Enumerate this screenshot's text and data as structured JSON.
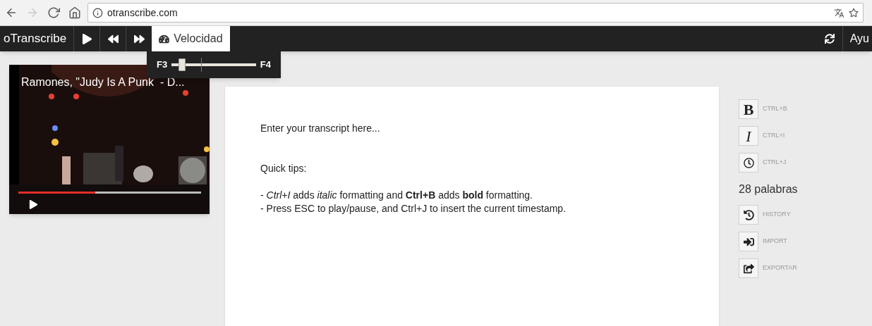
{
  "browser": {
    "url": "otranscribe.com",
    "nav": [
      {
        "kind": "back",
        "disabled": false
      },
      {
        "kind": "forward",
        "disabled": true
      },
      {
        "kind": "reload",
        "disabled": false
      },
      {
        "kind": "home",
        "disabled": false
      }
    ]
  },
  "toolbar": {
    "brand": "oTranscribe",
    "controls": [
      {
        "kind": "play"
      },
      {
        "kind": "rewind"
      },
      {
        "kind": "fastforward"
      }
    ],
    "speed": {
      "label": "Velocidad",
      "selected": true
    },
    "help": "Ayu"
  },
  "speed_popover": {
    "min_label": "F3",
    "max_label": "F4",
    "level": 0.12
  },
  "video": {
    "kind": "picture",
    "title": "Ramones, \"Judy Is A Punk  - D...",
    "progress": {
      "level": 0.42
    }
  },
  "editor": {
    "paragraphs": [
      {
        "kind": "intro",
        "lines": [
          "Enter your transcript here..."
        ]
      },
      {
        "kind": "heading",
        "lines": [
          "Quick tips:"
        ]
      },
      {
        "kind": "tips",
        "lines": [
          "- *Ctrl+I* adds *italic* formatting and **Ctrl+B** adds **bold** formatting.",
          "- Press ESC to play/pause, and Ctrl+J to insert the current timestamp."
        ]
      }
    ]
  },
  "sidebar": {
    "format_buttons": [
      {
        "kind": "bold",
        "glyph": "B",
        "shortcut": "CTRL+B"
      },
      {
        "kind": "italic",
        "glyph": "I",
        "shortcut": "CTRL+I"
      },
      {
        "kind": "timestamp",
        "shortcut": "CTRL+J"
      }
    ],
    "word_count": "28 palabras",
    "actions": [
      {
        "kind": "history",
        "label": "HISTORY"
      },
      {
        "kind": "import",
        "label": "IMPORT"
      },
      {
        "kind": "export",
        "label": "EXPORTAR"
      }
    ]
  }
}
